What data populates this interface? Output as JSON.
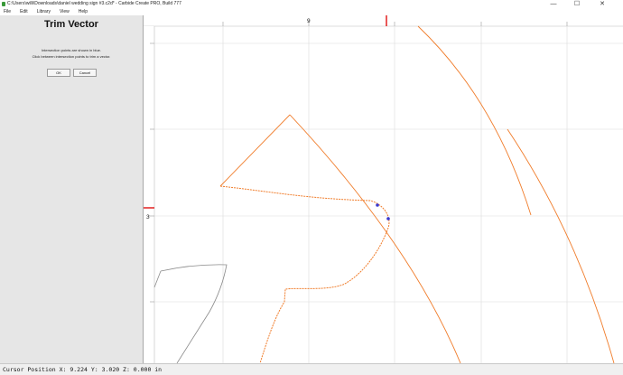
{
  "window": {
    "title": "C:\\Users\\willi\\Downloads\\daniel wedding sign #3.c2d* - Carbide Create PRO, Build 777",
    "minimize": "—",
    "maximize": "☐",
    "close": "✕"
  },
  "menu": [
    "File",
    "Edit",
    "Library",
    "View",
    "Help"
  ],
  "panel": {
    "title": "Trim Vector",
    "line1": "Intersection points are shown in blue.",
    "line2": "Click between intersection points to trim a vector.",
    "ok_label": "OK",
    "cancel_label": "Cancel"
  },
  "ruler": {
    "top_label": "9",
    "left_label": "3"
  },
  "status": {
    "text": "Cursor Position X: 9.224 Y: 3.020 Z: 0.000 in"
  },
  "colors": {
    "vector_selected": "#f07c2a",
    "vector_unselected": "#8a8a8a",
    "intersection": "#3a3ad0",
    "ruler_marker": "#e01010",
    "grid": "#dcdcdc"
  }
}
